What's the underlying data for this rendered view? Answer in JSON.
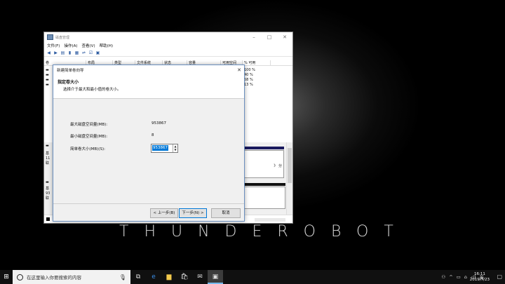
{
  "desktop": {
    "brand_text": "THUNDEROBOT"
  },
  "window": {
    "title": "磁盘管理",
    "menu": [
      "文件(F)",
      "操作(A)",
      "查看(V)",
      "帮助(H)"
    ],
    "columns": [
      "卷",
      "布局",
      "类型",
      "文件系统",
      "状态",
      "容量",
      "可用空间",
      "% 可用"
    ],
    "percent_values": [
      "100 %",
      "40 %",
      "58 %",
      "13 %"
    ],
    "disk_labels": [
      {
        "l1": "基",
        "l2": "11",
        "l3": "联"
      },
      {
        "l1": "基",
        "l2": "93",
        "l3": "联"
      }
    ],
    "partition_fragment": "》 分"
  },
  "dialog": {
    "title": "新建简单卷向导",
    "heading": "指定卷大小",
    "subheading": "选择介于最大和最小值的卷大小。",
    "max_label": "最大磁盘空间量(MB):",
    "max_value": "953867",
    "min_label": "最小磁盘空间量(MB):",
    "min_value": "8",
    "size_label": "简单卷大小(MB)(S):",
    "size_value": "953867",
    "back_button": "< 上一步(B)",
    "next_button": "下一步(N) >",
    "cancel_button": "取消"
  },
  "taskbar": {
    "search_placeholder": "在这里输入你要搜索的内容",
    "time": "16:11",
    "date": "2019/7/23"
  }
}
